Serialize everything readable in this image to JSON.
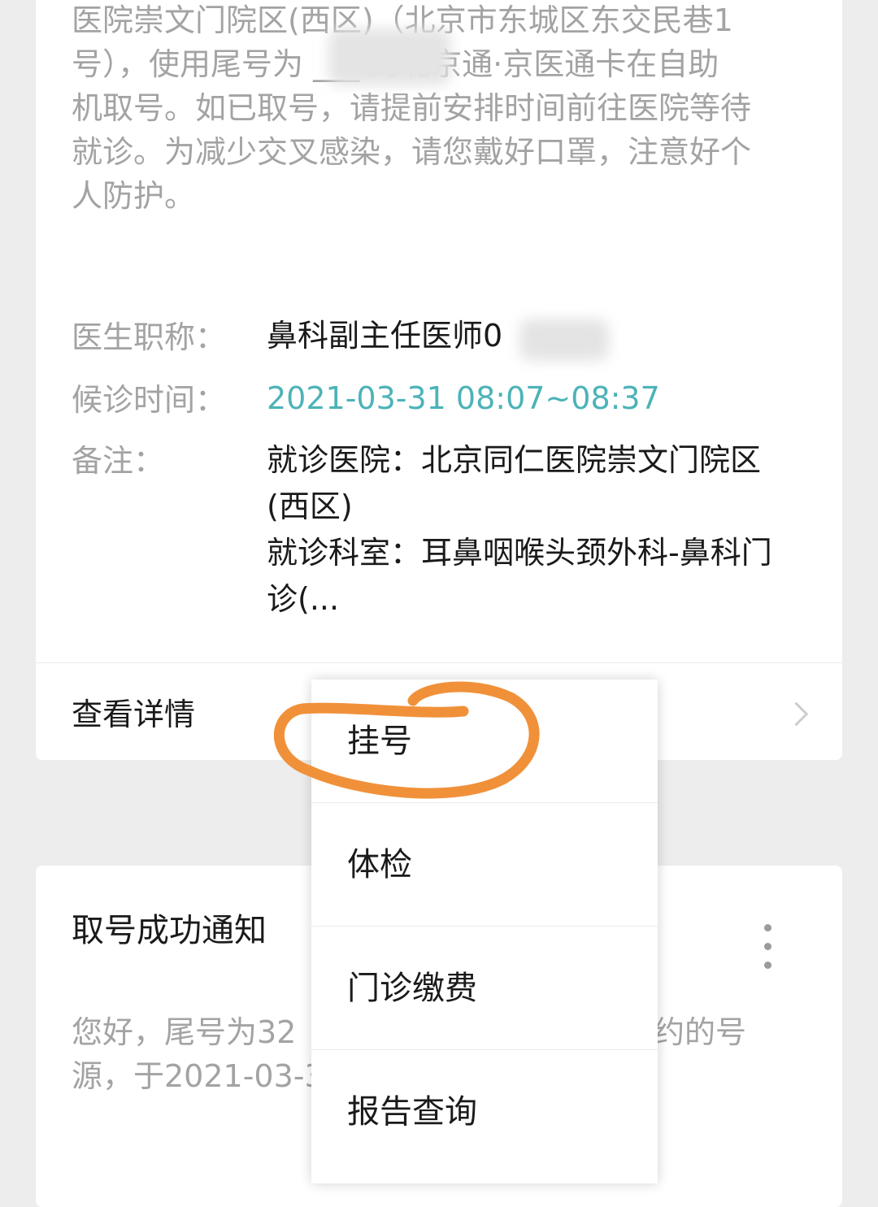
{
  "top_card": {
    "message_lines": [
      "医院崇文门院区(西区)（北京市东城区东交民巷1",
      "号），使用尾号为 ___ 的北京通·京医通卡在自助",
      "机取号。如已取号，请提前安排时间前往医院等待",
      "就诊。为减少交叉感染，请您戴好口罩，注意好个",
      "人防护。"
    ],
    "fields": {
      "doctor_label": "医生职称：",
      "doctor_value": "鼻科副主任医师0",
      "time_label": "候诊时间：",
      "time_value": "2021-03-31 08:07~08:37",
      "remark_label": "备注：",
      "remark_line1": "就诊医院：北京同仁医院崇文门院区",
      "remark_line2": "(西区)",
      "remark_line3": "就诊科室：耳鼻咽喉头颈外科-鼻科门",
      "remark_line4": "诊(..."
    },
    "detail_link": "查看详情"
  },
  "bottom_card": {
    "title": "取号成功通知",
    "body_line1_left": "您好，尾号为32",
    "body_line1_right": "约的号",
    "body_line2_left": "源，于2021-03-3"
  },
  "menu": {
    "items": [
      "挂号",
      "体检",
      "门诊缴费",
      "报告查询"
    ]
  },
  "colors": {
    "background": "#ededed",
    "card": "#ffffff",
    "muted_text": "#a3a3a3",
    "time_accent": "#4cb3b8",
    "annotation": "#f0913a"
  },
  "icons": {
    "chevron": "chevron-right-icon",
    "more": "more-vertical-icon"
  }
}
